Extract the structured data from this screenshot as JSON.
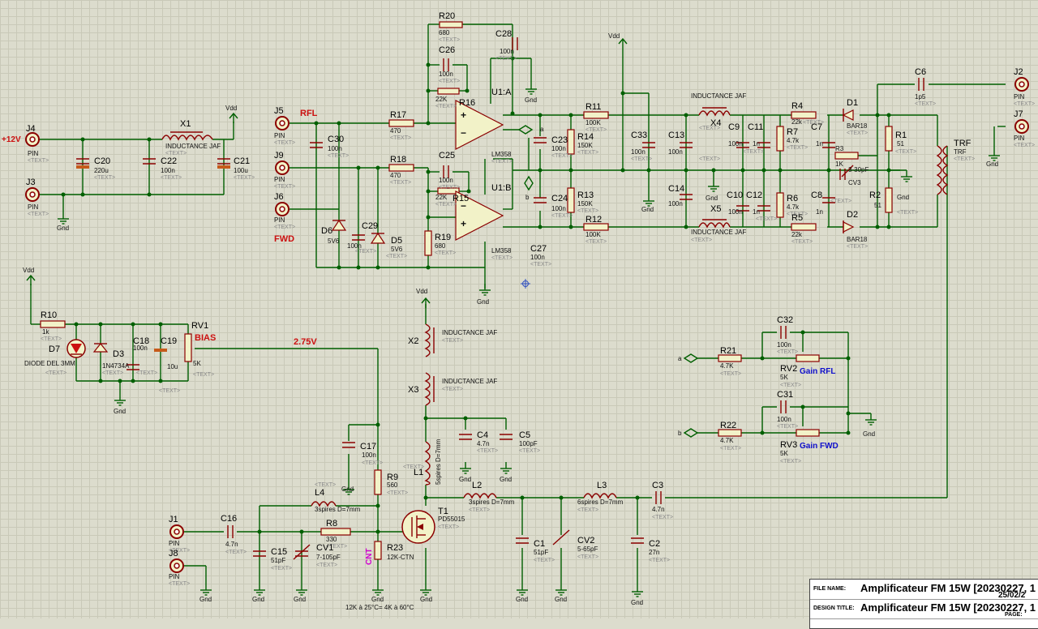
{
  "schematic": {
    "labels": {
      "supply": "+12V",
      "rfl": "RFL",
      "fwd": "FWD",
      "bias": "BIAS",
      "bias_voltage": "2.75V",
      "gain_rfl": "Gain RFL",
      "gain_fwd": "Gain FWD",
      "cnt": "CNT",
      "thermistor_note": "12K à 25°C= 4K à 60°C",
      "vdd": "Vdd",
      "gnd": "Gnd",
      "pin": "PIN",
      "text": "<TEXT>",
      "net_a": "a",
      "net_b": "b"
    },
    "components": {
      "J4": "J4",
      "J3": "J3",
      "J5": "J5",
      "J9": "J9",
      "J6": "J6",
      "J1": "J1",
      "J8": "J8",
      "J2": "J2",
      "J7": "J7",
      "X1": "X1",
      "X1_val": "INDUCTANCE JAF",
      "C20": "C20",
      "C20_val": "220u",
      "C22": "C22",
      "C22_val": "100n",
      "C21": "C21",
      "C21_val": "100u",
      "R20": "R20",
      "R20_val": "680",
      "C28": "C28",
      "C28_val": "100n",
      "C26": "C26",
      "C26_val": "100n",
      "R16": "R16",
      "R16_val": "22K",
      "R17": "R17",
      "R17_val": "470",
      "C30": "C30",
      "C30_val": "100n",
      "R18": "R18",
      "R18_val": "470",
      "C25": "C25",
      "C25_val": "100n",
      "R15": "R15",
      "R15_val": "22K",
      "U1A": "U1:A",
      "U1B": "U1:B",
      "U1_val": "LM358",
      "D6": "D6",
      "D6_val": "5V6",
      "C29": "C29",
      "C29_val": "100n",
      "D5": "D5",
      "D5_val": "5V6",
      "R19": "R19",
      "R19_val": "680",
      "C27": "C27",
      "C27_val": "100n",
      "R11": "R11",
      "R11_val": "100K",
      "R14": "R14",
      "R14_val": "150K",
      "C23": "C23",
      "C23_val": "100n",
      "C24": "C24",
      "C24_val": "100n",
      "R13": "R13",
      "R13_val": "150K",
      "R12": "R12",
      "R12_val": "100K",
      "C33": "C33",
      "C33_val": "100n",
      "C13": "C13",
      "C13_val": "100n",
      "C14": "C14",
      "C14_val": "100n",
      "X4": "X4",
      "X4_val": "INDUCTANCE JAF",
      "X5": "X5",
      "X5_val": "INDUCTANCE JAF",
      "C9": "C9",
      "C9_val": "100n",
      "C11": "C11",
      "C11_val": "1n",
      "C10": "C10",
      "C10_val": "100n",
      "C12": "C12",
      "C12_val": "1n",
      "R7": "R7",
      "R7_val": "4.7k",
      "R6": "R6",
      "R6_val": "4.7k",
      "R4": "R4",
      "R4_val": "22k",
      "R5": "R5",
      "R5_val": "22k",
      "C7": "C7",
      "C7_val": "1n",
      "C8": "C8",
      "C8_val": "1n",
      "R3": "R3",
      "R3_val": "1K",
      "CV3": "CV3",
      "CV3_val": "3-30pF",
      "D1": "D1",
      "D1_val": "BAR18",
      "D2": "D2",
      "D2_val": "BAR18",
      "R1": "R1",
      "R1_val": "51",
      "R2": "R2",
      "R2_val": "51",
      "C6": "C6",
      "C6_val": "1p5",
      "TRF": "TRF",
      "R10": "R10",
      "R10_val": "1k",
      "D7": "D7",
      "D7_val": "DIODE DEL 3MM",
      "D3": "D3",
      "D3_val": "1N4734A",
      "C18": "C18",
      "C18_val": "100n",
      "C19": "C19",
      "C19_val": "10u",
      "RV1": "RV1",
      "RV1_val": "5K",
      "X2": "X2",
      "X2_val": "INDUCTANCE JAF",
      "X3": "X3",
      "X3_val": "INDUCTANCE JAF",
      "C4": "C4",
      "C4_val": "4.7n",
      "C5": "C5",
      "C5_val": "100pF",
      "C17": "C17",
      "C17_val": "100n",
      "R9": "R9",
      "R9_val": "560",
      "L4": "L4",
      "L4_val": "3spires D=7mm",
      "L1": "L1",
      "L1_val": "5spires D=7mm",
      "L2": "L2",
      "L2_val": "3spires D=7mm",
      "L3": "L3",
      "L3_val": "6spires D=7mm",
      "T1": "T1",
      "T1_val": "PD55015",
      "C16": "C16",
      "C16_val": "4.7n",
      "R8": "R8",
      "R8_val": "330",
      "C15": "C15",
      "C15_val": "51pF",
      "CV1": "CV1",
      "CV1_val": "7-105pF",
      "R23": "R23",
      "R23_val": "12K-CTN",
      "C1": "C1",
      "C1_val": "51pF",
      "CV2": "CV2",
      "CV2_val": "5-65pF",
      "C2": "C2",
      "C2_val": "27n",
      "C3": "C3",
      "C3_val": "4.7n",
      "C32": "C32",
      "C32_val": "100n",
      "R21": "R21",
      "R21_val": "4.7K",
      "RV2": "RV2",
      "RV2_val": "5K",
      "C31": "C31",
      "C31_val": "100n",
      "R22": "R22",
      "R22_val": "4.7K",
      "RV3": "RV3",
      "RV3_val": "5K"
    }
  },
  "title_block": {
    "file_name_label": "FILE NAME:",
    "file_name_value": "Amplificateur FM 15W [20230227, 1",
    "date_value": "25/02/2",
    "design_title_label": "DESIGN TITLE:",
    "design_title_value": "Amplificateur FM 15W [20230227, 1",
    "page_label": "PAGE:"
  }
}
